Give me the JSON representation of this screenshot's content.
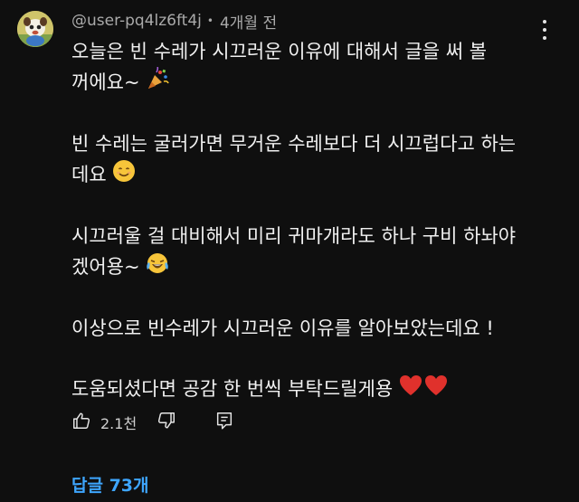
{
  "comment": {
    "author_handle": "@user-pq4lz6ft4j",
    "separator": "•",
    "posted_time": "4개월 전",
    "paragraphs": [
      {
        "text": "오늘은 빈 수레가 시끄러운 이유에 대해서 글을 써 볼 꺼에요~",
        "emoji": "party-popper-icon"
      },
      {
        "text": "빈 수레는 굴러가면 무거운 수레보다 더 시끄럽다고 하는 데요",
        "emoji": "smiling-face-icon"
      },
      {
        "text": "시끄러울 걸 대비해서 미리 귀마개라도 하나 구비 하놔야 겠어용~",
        "emoji": "tears-of-joy-icon"
      },
      {
        "text": "이상으로 빈수레가 시끄러운 이유를 알아보았는데요 !",
        "emoji": ""
      },
      {
        "text": "도움되셨다면 공감 한 번씩 부탁드릴게용",
        "emoji": "red-hearts-icon"
      }
    ],
    "like_count": "2.1천",
    "replies_link": "답글 73개"
  },
  "colors": {
    "background": "#0f0f0f",
    "text": "#f1f1f1",
    "meta": "#aaaaaa",
    "link": "#3ea6ff"
  }
}
